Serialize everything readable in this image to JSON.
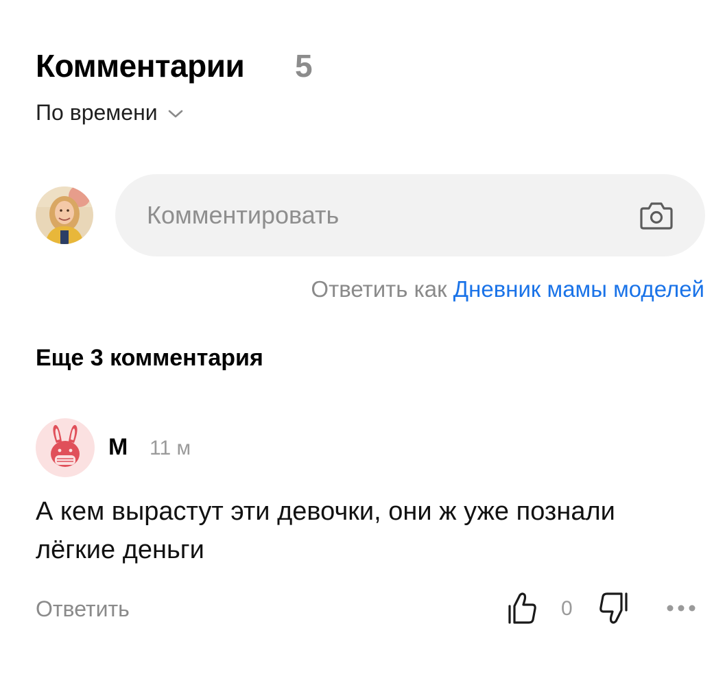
{
  "header": {
    "title": "Комментарии",
    "count": "5",
    "sort_label": "По времени"
  },
  "compose": {
    "placeholder": "Комментировать",
    "reply_as_label": "Ответить как",
    "reply_as_name": "Дневник мамы моделей",
    "camera_icon": "camera-icon"
  },
  "more_comments": "Еще 3 комментария",
  "comment": {
    "author": "М",
    "time": "11 м",
    "text": "А кем вырастут эти девочки, они ж уже познали лёгкие деньги",
    "reply_label": "Ответить",
    "rating": "0",
    "icons": [
      "thumbs-up-icon",
      "thumbs-down-icon",
      "more-options-icon"
    ]
  },
  "colors": {
    "link": "#1a73e8",
    "muted": "#8a8a8a",
    "input_bg": "#f2f2f2",
    "author_avatar_bg": "#fbe1e1",
    "author_avatar_fg": "#e0505a"
  }
}
